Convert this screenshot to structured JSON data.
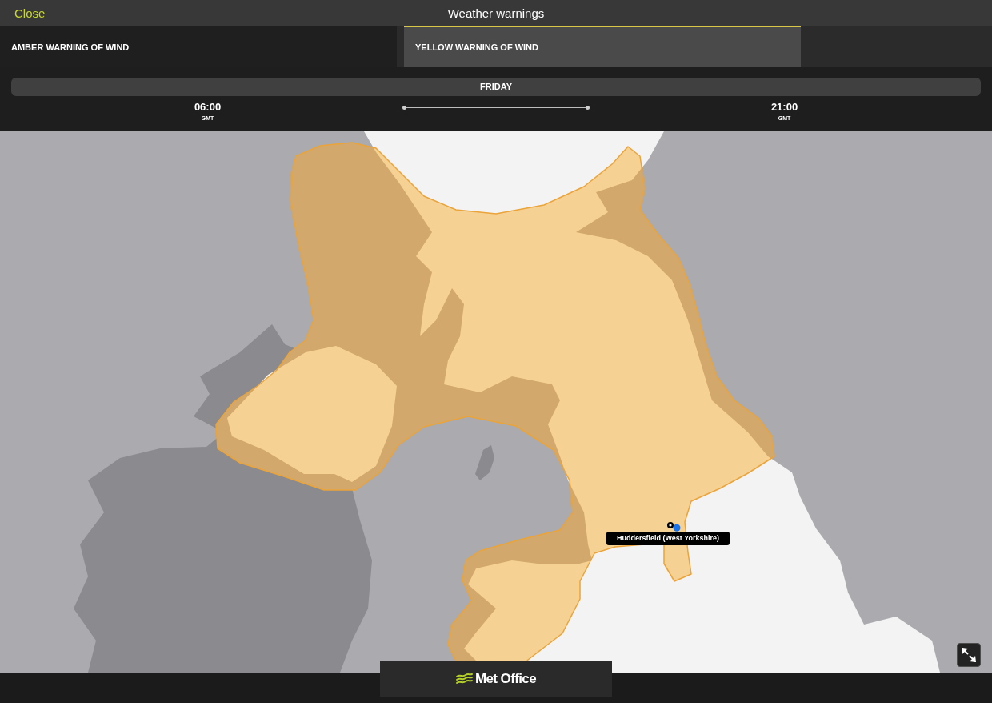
{
  "header": {
    "close": "Close",
    "title": "Weather warnings"
  },
  "tabs": [
    {
      "label": "AMBER WARNING OF WIND",
      "selected": false
    },
    {
      "label": "YELLOW WARNING OF WIND",
      "selected": true
    }
  ],
  "timeline": {
    "day": "FRIDAY",
    "start": {
      "time": "06:00",
      "zone": "GMT"
    },
    "end": {
      "time": "21:00",
      "zone": "GMT"
    }
  },
  "map": {
    "location": {
      "label": "Huddersfield (West Yorkshire)"
    }
  },
  "footer": {
    "logo": "Met Office"
  }
}
